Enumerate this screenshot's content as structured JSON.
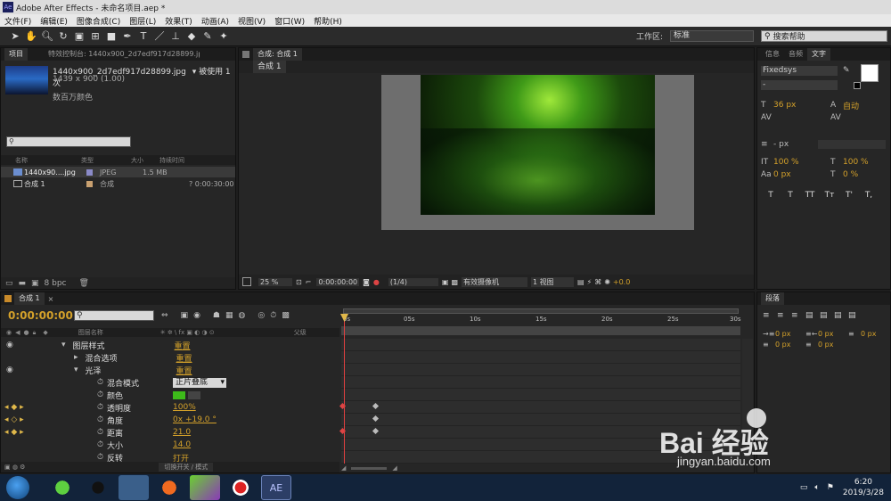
{
  "window": {
    "title": "Adobe After Effects - 未命名项目.aep *"
  },
  "menu": [
    "文件(F)",
    "编辑(E)",
    "图像合成(C)",
    "图层(L)",
    "效果(T)",
    "动画(A)",
    "视图(V)",
    "窗口(W)",
    "帮助(H)"
  ],
  "toolbar": {
    "workspace_label": "工作区:",
    "workspace_value": "标准",
    "search_placeholder": "搜索帮助"
  },
  "project": {
    "tab_project": "项目",
    "tab_effects": "特效控制台: 1440x900_2d7edf917d28899.jpg",
    "asset_name": "1440x900_2d7edf917d28899.jpg",
    "asset_used": "▾ 被使用 1次",
    "asset_dims": "1439 x 900 (1.00)",
    "asset_color": "数百万颜色",
    "columns": [
      "名称",
      "类型",
      "大小",
      "持续时间"
    ],
    "items": [
      {
        "name": "1440x90....jpg",
        "type": "JPEG",
        "size": "1.5 MB",
        "duration": ""
      },
      {
        "name": "合成 1",
        "type": "合成",
        "size": "",
        "duration": "? 0:00:30:00"
      }
    ],
    "bpc": "8 bpc"
  },
  "composition": {
    "tab": "合成: 合成 1",
    "subtab": "合成 1",
    "zoom": "25 %",
    "timecode": "0:00:00:00",
    "resolution": "(1/4)",
    "camera": "有效摄像机",
    "view": "1 视图",
    "exposure": "+0.0"
  },
  "right_panel": {
    "tabs": [
      "信息",
      "音频",
      "文字"
    ],
    "font": "Fixedsys",
    "font_style": "-",
    "font_size": "36 px",
    "leading": "自动",
    "tracking_unit": "- px",
    "vscale": "100 %",
    "hscale": "100 %",
    "baseline": "0 px",
    "tsume": "0 %",
    "style_buttons": [
      "T",
      "T",
      "TT",
      "Tт",
      "T'",
      "T,"
    ]
  },
  "paragraph_panel": {
    "tab": "段落",
    "values": [
      "0 px",
      "0 px",
      "0 px",
      "0 px",
      "0 px"
    ]
  },
  "timeline": {
    "tab": "合成 1",
    "timecode": "0:00:00:00",
    "col_layer": "图层名称",
    "col_parent": "父级",
    "ruler": [
      "0s",
      "05s",
      "10s",
      "15s",
      "20s",
      "25s",
      "30s"
    ],
    "toggle_label": "切换开关 / 模式",
    "layers": [
      {
        "name": "图层样式",
        "value": "重置",
        "indent": 1,
        "arrow": "▾"
      },
      {
        "name": "混合选项",
        "value": "重置",
        "indent": 2,
        "arrow": "▸"
      },
      {
        "name": "光泽",
        "value": "重置",
        "indent": 2,
        "arrow": "▾"
      },
      {
        "name": "混合模式",
        "value": "正片叠底",
        "indent": 3,
        "arrow": ""
      },
      {
        "name": "颜色",
        "value": "",
        "indent": 3,
        "arrow": ""
      },
      {
        "name": "透明度",
        "value": "100%",
        "indent": 3,
        "arrow": ""
      },
      {
        "name": "角度",
        "value": "0x +19.0 °",
        "indent": 3,
        "arrow": ""
      },
      {
        "name": "距离",
        "value": "21.0",
        "indent": 3,
        "arrow": ""
      },
      {
        "name": "大小",
        "value": "14.0",
        "indent": 3,
        "arrow": ""
      },
      {
        "name": "反转",
        "value": "打开",
        "indent": 3,
        "arrow": ""
      }
    ]
  },
  "taskbar": {
    "time": "6:20",
    "date": "2019/3/28",
    "ae_label": "AE"
  },
  "watermark": {
    "text": "Bai 经验",
    "url": "jingyan.baidu.com"
  },
  "colors": {
    "accent": "#d4a12a",
    "glow_green": "#5ec21c",
    "swatch": "#3dbb1a"
  }
}
